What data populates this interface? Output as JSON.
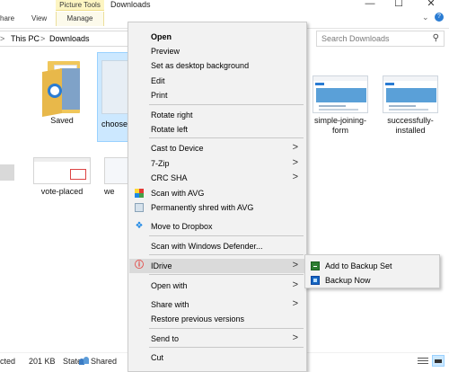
{
  "titlebar": {
    "context_tab": "Picture Tools",
    "title": "Downloads",
    "minimize": "—",
    "maximize": "☐",
    "close": "✕"
  },
  "ribbon": {
    "tabs": [
      "hare",
      "View",
      "Manage"
    ],
    "expand_icon": "chevron-down-icon",
    "help_icon": "help-icon"
  },
  "address": {
    "crumbs": [
      "This PC",
      "Downloads"
    ],
    "separator": ">",
    "refresh_glyph": ")"
  },
  "search": {
    "placeholder": "Search Downloads"
  },
  "files": [
    {
      "label": "Saved",
      "kind": "folder"
    },
    {
      "label": "choose ba",
      "kind": "image",
      "selected": true
    },
    {
      "label": "simple-joining-form",
      "kind": "image"
    },
    {
      "label": "successfully-installed",
      "kind": "image"
    },
    {
      "label": "vote-placed",
      "kind": "image"
    },
    {
      "label": "we",
      "kind": "image"
    }
  ],
  "status": {
    "selected": "cted",
    "size": "201 KB",
    "state_label": "State:",
    "state_value": "Shared"
  },
  "context_menu": {
    "items": [
      {
        "label": "Open",
        "bold": true
      },
      {
        "label": "Preview"
      },
      {
        "label": "Set as desktop background"
      },
      {
        "label": "Edit"
      },
      {
        "label": "Print"
      },
      {
        "label": "Rotate right"
      },
      {
        "label": "Rotate left"
      },
      {
        "label": "Cast to Device",
        "submenu": true
      },
      {
        "label": "7-Zip",
        "submenu": true
      },
      {
        "label": "CRC SHA",
        "submenu": true
      },
      {
        "label": "Scan with AVG",
        "icon": "avg-icon"
      },
      {
        "label": "Permanently shred with AVG",
        "icon": "shred-icon"
      },
      {
        "label": "Move to Dropbox",
        "icon": "dropbox-icon"
      },
      {
        "label": "Scan with Windows Defender..."
      },
      {
        "label": "IDrive",
        "submenu": true,
        "icon": "idrive-icon",
        "highlighted": true
      },
      {
        "label": "Open with",
        "submenu": true
      },
      {
        "label": "Share with",
        "submenu": true
      },
      {
        "label": "Restore previous versions"
      },
      {
        "label": "Send to",
        "submenu": true
      },
      {
        "label": "Cut"
      }
    ],
    "submenu_arrow": ">"
  },
  "idrive_submenu": {
    "items": [
      {
        "label": "Add to Backup Set",
        "icon": "backup-set-icon"
      },
      {
        "label": "Backup Now",
        "icon": "backup-now-icon"
      }
    ]
  },
  "colors": {
    "selection": "#cce8ff",
    "menu_bg": "#f2f2f2",
    "menu_highlight": "#dadada",
    "context_tab": "#fdf5c2"
  }
}
